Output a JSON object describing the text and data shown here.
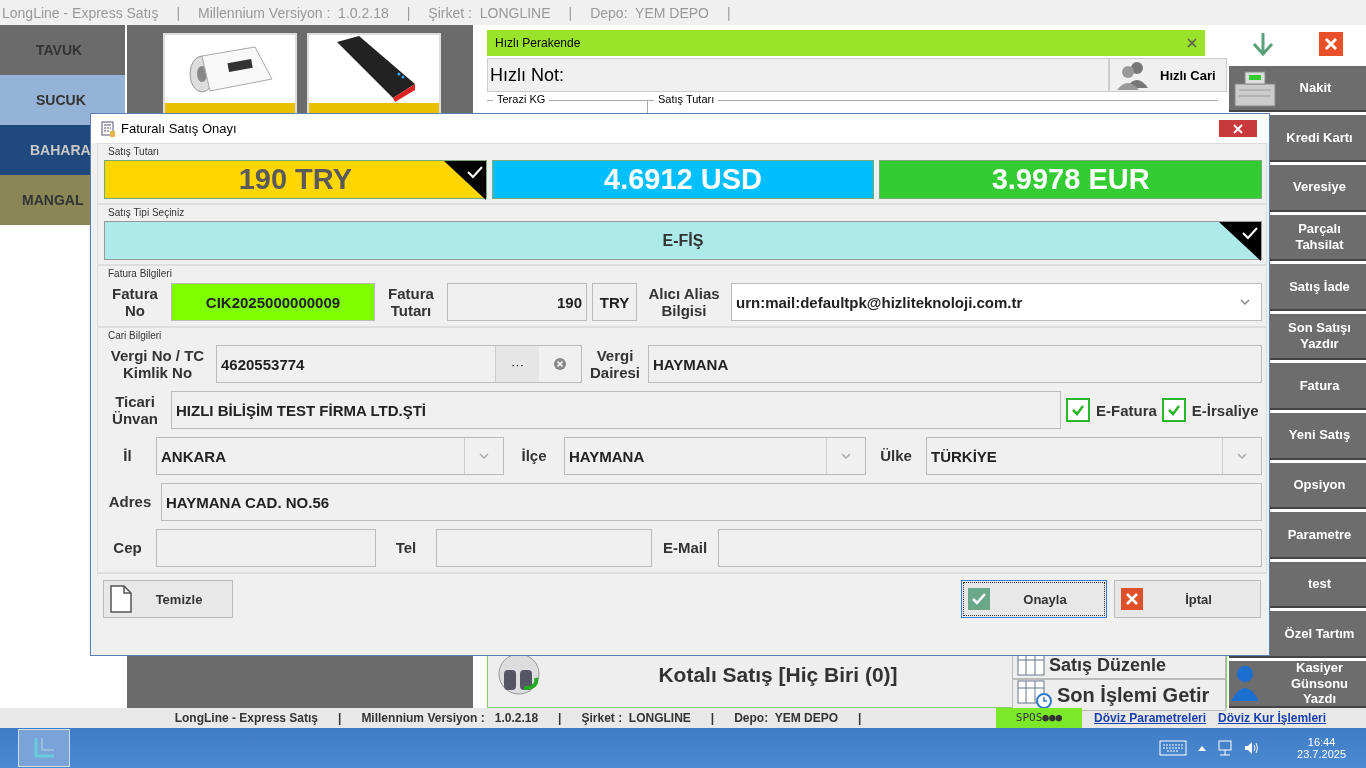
{
  "title_bar": {
    "items": [
      "LongLine - Express Satış",
      "|",
      "Millennium Versiyon :  1.0.2.18",
      "|",
      "Şirket :  LONGLINE",
      "|",
      "Depo:  YEM DEPO",
      "|"
    ]
  },
  "categories": [
    {
      "label": "TAVUK",
      "color": "#6b6b6b"
    },
    {
      "label": "SUCUK",
      "color": "#95b3d7"
    },
    {
      "label": "BAHARA",
      "color": "#1f497d"
    },
    {
      "label": "MANGAL",
      "color": "#8b8656"
    }
  ],
  "products": [
    {
      "kind": "roll"
    },
    {
      "kind": "powerbank"
    }
  ],
  "sales_panel": {
    "tab_title": "Hızlı Perakende",
    "note_label": "Hızlı Not:",
    "quick_customer_button": "Hızlı Cari",
    "groups": [
      "Terazi KG",
      "Satış Tutarı"
    ],
    "quota_sale": "Kotalı Satış [Hiç Biri (0)]",
    "edit_sale_button": "Satış Düzenle",
    "last_transaction_button": "Son İşlemi Getir"
  },
  "action_buttons": [
    {
      "label": "Nakit",
      "kind": "register"
    },
    {
      "label": "Kredi Kartı",
      "kind": "plain"
    },
    {
      "label": "Veresiye",
      "kind": "plain"
    },
    {
      "label": "Parçalı Tahsilat",
      "kind": "plain"
    },
    {
      "label": "Satış İade",
      "kind": "plain"
    },
    {
      "label": "Son Satışı Yazdır",
      "kind": "plain"
    },
    {
      "label": "Fatura",
      "kind": "plain"
    },
    {
      "label": "Yeni Satış",
      "kind": "plain"
    },
    {
      "label": "Opsiyon",
      "kind": "plain"
    },
    {
      "label": "Parametre",
      "kind": "plain"
    },
    {
      "label": "test",
      "kind": "plain"
    },
    {
      "label": "Özel Tartım",
      "kind": "plain"
    },
    {
      "label": "Kasiyer Günsonu Yazdı",
      "kind": "cashier"
    }
  ],
  "dialog": {
    "title": "Faturalı Satış Onayı",
    "amounts_group": "Satış Tutarı",
    "amounts": [
      {
        "text": "190 TRY",
        "color": "#ffd700",
        "selected": true
      },
      {
        "text": "4.6912 USD",
        "color": "#00bfff",
        "selected": false
      },
      {
        "text": "3.9978 EUR",
        "color": "#33cc33",
        "selected": false
      }
    ],
    "type_group": "Satış Tipi Seçiniz",
    "sale_types": [
      {
        "label": "E-FİŞ",
        "selected": true
      }
    ],
    "invoice_group": "Fatura Bilgileri",
    "invoice_no_label": "Fatura No",
    "invoice_no": "CIK2025000000009",
    "invoice_total_label": "Fatura Tutarı",
    "invoice_total": "190",
    "currency": "TRY",
    "alias_label": "Alıcı Alias Bilgisi",
    "alias": "urn:mail:defaultpk@hizliteknoloji.com.tr",
    "customer_group": "Cari Bilgileri",
    "tax_no_label": "Vergi No / TC Kimlik No",
    "tax_no": "4620553774",
    "browse_button": "···",
    "tax_office_label": "Vergi Dairesi",
    "tax_office": "HAYMANA",
    "company_label": "Ticari Ünvan",
    "company": "HIZLI BİLİŞİM TEST FİRMA LTD.ŞTİ",
    "checkboxes": [
      {
        "label": "E-Fatura",
        "checked": true
      },
      {
        "label": "E-İrsaliye",
        "checked": true
      }
    ],
    "province_label": "İl",
    "province": "ANKARA",
    "district_label": "İlçe",
    "district": "HAYMANA",
    "country_label": "Ülke",
    "country": "TÜRKİYE",
    "address_label": "Adres",
    "address": "HAYMANA CAD. NO.56",
    "mobile_label": "Cep",
    "phone_label": "Tel",
    "email_label": "E-Mail",
    "clear_button": "Temizle",
    "confirm_button": "Onayla",
    "cancel_button": "İptal"
  },
  "status_bar": {
    "items": [
      "LongLine - Express Satış",
      "|",
      "Millennium Versiyon :   1.0.2.18",
      "|",
      "Şirket :  LONGLINE",
      "|",
      "Depo:  YEM DEPO",
      "|"
    ],
    "spos": "SPOS●●●",
    "links": [
      "Döviz Parametreleri",
      "Döviz Kur İşlemleri"
    ]
  },
  "taskbar": {
    "time": "16:44",
    "date": "23.7.2025"
  }
}
